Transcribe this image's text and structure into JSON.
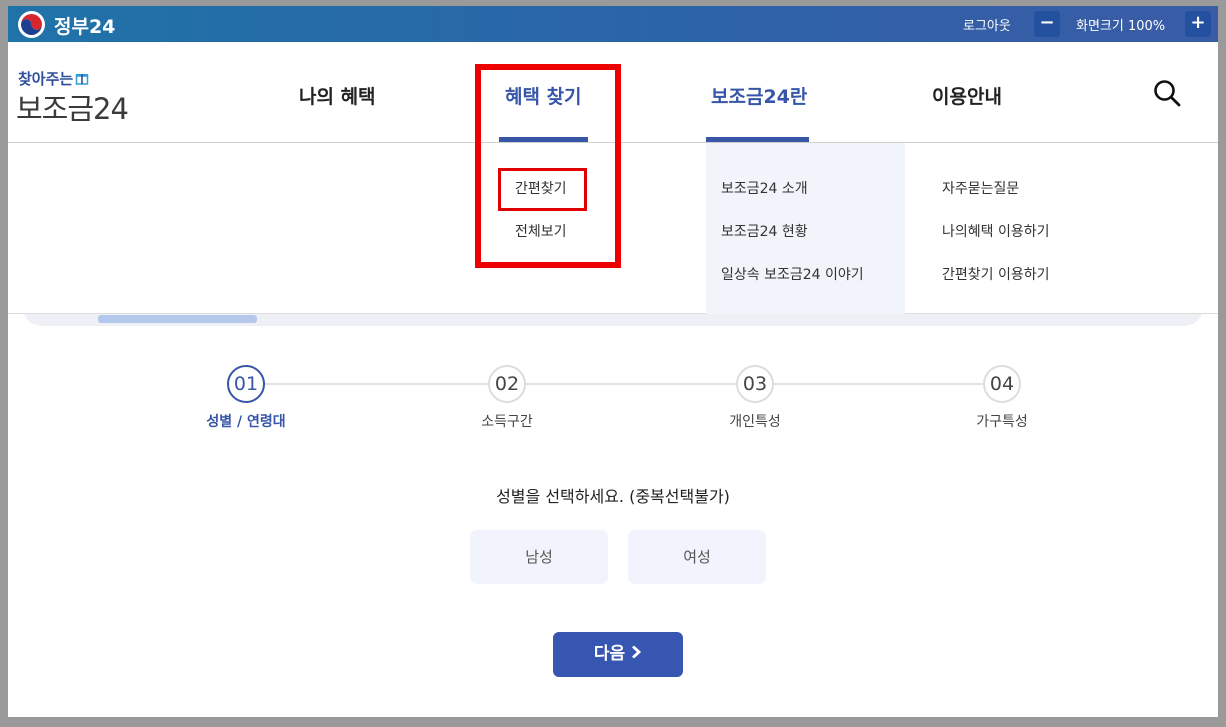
{
  "govbar": {
    "site_name": "정부24",
    "logout": "로그아웃",
    "zoom_minus": "−",
    "zoom_label": "화면크기 100%",
    "zoom_plus": "+"
  },
  "brand": {
    "tagline": "찾아주는",
    "name": "보조금24",
    "tagline_icon": "gift-icon"
  },
  "nav": {
    "items": [
      {
        "label": "나의 혜택"
      },
      {
        "label": "혜택 찾기"
      },
      {
        "label": "보조금24란"
      },
      {
        "label": "이용안내"
      }
    ],
    "search_icon": "search-icon"
  },
  "dropdown": {
    "find": [
      "간편찾기",
      "전체보기"
    ],
    "about": [
      "보조금24 소개",
      "보조금24 현황",
      "일상속 보조금24 이야기"
    ],
    "guide": [
      "자주묻는질문",
      "나의혜택 이용하기",
      "간편찾기 이용하기"
    ]
  },
  "steps": [
    {
      "num": "01",
      "label": "성별 / 연령대"
    },
    {
      "num": "02",
      "label": "소득구간"
    },
    {
      "num": "03",
      "label": "개인특성"
    },
    {
      "num": "04",
      "label": "가구특성"
    }
  ],
  "question": "성별을 선택하세요. (중복선택불가)",
  "choices": [
    "남성",
    "여성"
  ],
  "next_button": "다음",
  "colors": {
    "accent": "#3756a8",
    "highlight_red": "#ee0000",
    "govbar": "#2c64a8"
  }
}
